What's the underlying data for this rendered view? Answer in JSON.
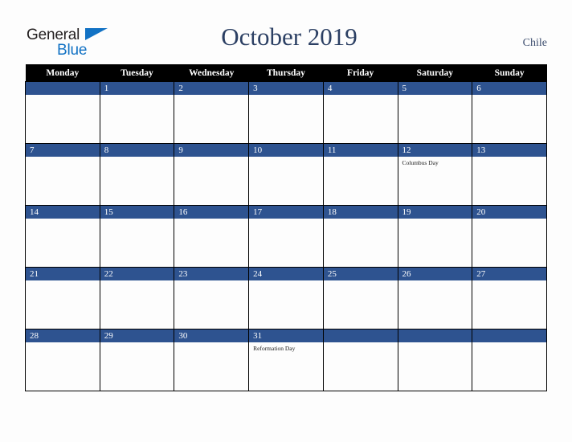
{
  "brand": {
    "name_part1": "General",
    "name_part2": "Blue",
    "triangle_color": "#1272c4",
    "text_color": "#231f20"
  },
  "header": {
    "title": "October 2019",
    "country": "Chile",
    "title_color": "#2b3f63"
  },
  "calendar": {
    "weekday_headers": [
      "Monday",
      "Tuesday",
      "Wednesday",
      "Thursday",
      "Friday",
      "Saturday",
      "Sunday"
    ],
    "header_bg": "#000000",
    "header_text_color": "#ffffff",
    "daynum_band_color": "#2e5390",
    "cell_bg": "#fdfdfd",
    "weeks": [
      [
        {
          "day": "",
          "event": ""
        },
        {
          "day": "1",
          "event": ""
        },
        {
          "day": "2",
          "event": ""
        },
        {
          "day": "3",
          "event": ""
        },
        {
          "day": "4",
          "event": ""
        },
        {
          "day": "5",
          "event": ""
        },
        {
          "day": "6",
          "event": ""
        }
      ],
      [
        {
          "day": "7",
          "event": ""
        },
        {
          "day": "8",
          "event": ""
        },
        {
          "day": "9",
          "event": ""
        },
        {
          "day": "10",
          "event": ""
        },
        {
          "day": "11",
          "event": ""
        },
        {
          "day": "12",
          "event": "Columbus Day"
        },
        {
          "day": "13",
          "event": ""
        }
      ],
      [
        {
          "day": "14",
          "event": ""
        },
        {
          "day": "15",
          "event": ""
        },
        {
          "day": "16",
          "event": ""
        },
        {
          "day": "17",
          "event": ""
        },
        {
          "day": "18",
          "event": ""
        },
        {
          "day": "19",
          "event": ""
        },
        {
          "day": "20",
          "event": ""
        }
      ],
      [
        {
          "day": "21",
          "event": ""
        },
        {
          "day": "22",
          "event": ""
        },
        {
          "day": "23",
          "event": ""
        },
        {
          "day": "24",
          "event": ""
        },
        {
          "day": "25",
          "event": ""
        },
        {
          "day": "26",
          "event": ""
        },
        {
          "day": "27",
          "event": ""
        }
      ],
      [
        {
          "day": "28",
          "event": ""
        },
        {
          "day": "29",
          "event": ""
        },
        {
          "day": "30",
          "event": ""
        },
        {
          "day": "31",
          "event": "Reformation Day"
        },
        {
          "day": "",
          "event": ""
        },
        {
          "day": "",
          "event": ""
        },
        {
          "day": "",
          "event": ""
        }
      ]
    ]
  }
}
